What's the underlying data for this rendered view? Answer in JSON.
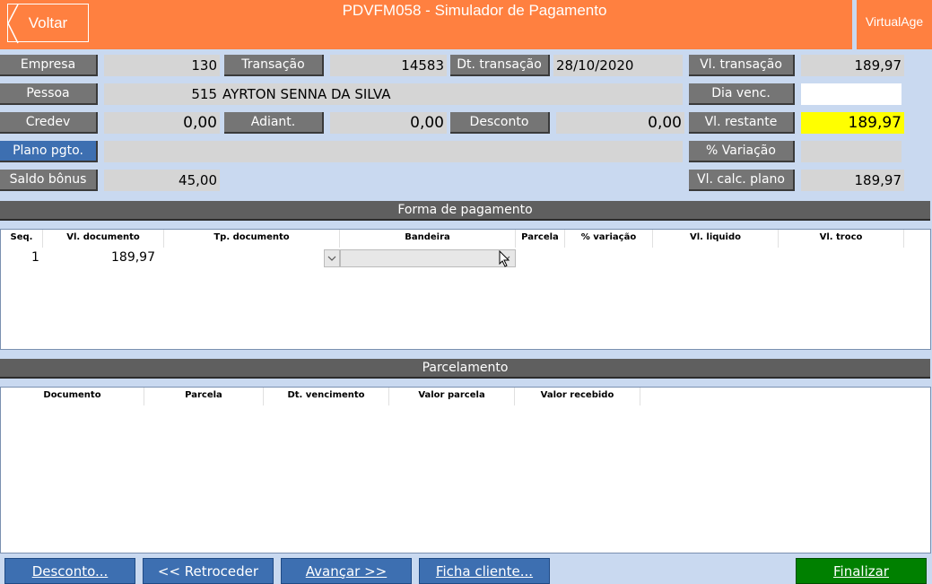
{
  "header": {
    "title": "PDVFM058 - Simulador de Pagamento",
    "back_label": "Voltar",
    "brand": "VirtualAge"
  },
  "form": {
    "empresa_label": "Empresa",
    "empresa_value": "130",
    "transacao_label": "Transação",
    "transacao_value": "14583",
    "dt_transacao_label": "Dt. transação",
    "dt_transacao_value": "28/10/2020",
    "vl_transacao_label": "Vl. transação",
    "vl_transacao_value": "189,97",
    "pessoa_label": "Pessoa",
    "pessoa_code": "515",
    "pessoa_name": "AYRTON SENNA DA SILVA",
    "dia_venc_label": "Dia venc.",
    "dia_venc_value": "",
    "credev_label": "Credev",
    "credev_value": "0,00",
    "adiant_label": "Adiant.",
    "adiant_value": "0,00",
    "desconto_label": "Desconto",
    "desconto_value": "0,00",
    "vl_restante_label": "Vl. restante",
    "vl_restante_value": "189,97",
    "plano_label": "Plano pgto.",
    "plano_value": "",
    "variacao_label": "% Variação",
    "variacao_value": "",
    "saldo_bonus_label": "Saldo bônus",
    "saldo_bonus_value": "45,00",
    "vl_calc_plano_label": "Vl. calc. plano",
    "vl_calc_plano_value": "189,97"
  },
  "forma_pagamento": {
    "title": "Forma de pagamento",
    "columns": [
      "Seq.",
      "Vl. documento",
      "Tp. documento",
      "Bandeira",
      "Parcela",
      "% variação",
      "Vl. liquido",
      "Vl. troco"
    ],
    "rows": [
      {
        "seq": "1",
        "vl_documento": "189,97",
        "tp_documento": "",
        "bandeira": ""
      }
    ]
  },
  "parcelamento": {
    "title": "Parcelamento",
    "columns": [
      "Documento",
      "Parcela",
      "Dt. vencimento",
      "Valor parcela",
      "Valor recebido"
    ]
  },
  "footer": {
    "desconto_btn": "Desconto...",
    "retroceder_btn": "<< Retroceder",
    "avancar_btn": "Avançar >>",
    "ficha_btn": "Ficha cliente...",
    "finalizar_btn": "Finalizar"
  },
  "colors": {
    "header_orange": "#ff8040",
    "background_blue": "#c9d9f0",
    "highlight_yellow": "#ffff00",
    "finalize_green": "#008000"
  }
}
